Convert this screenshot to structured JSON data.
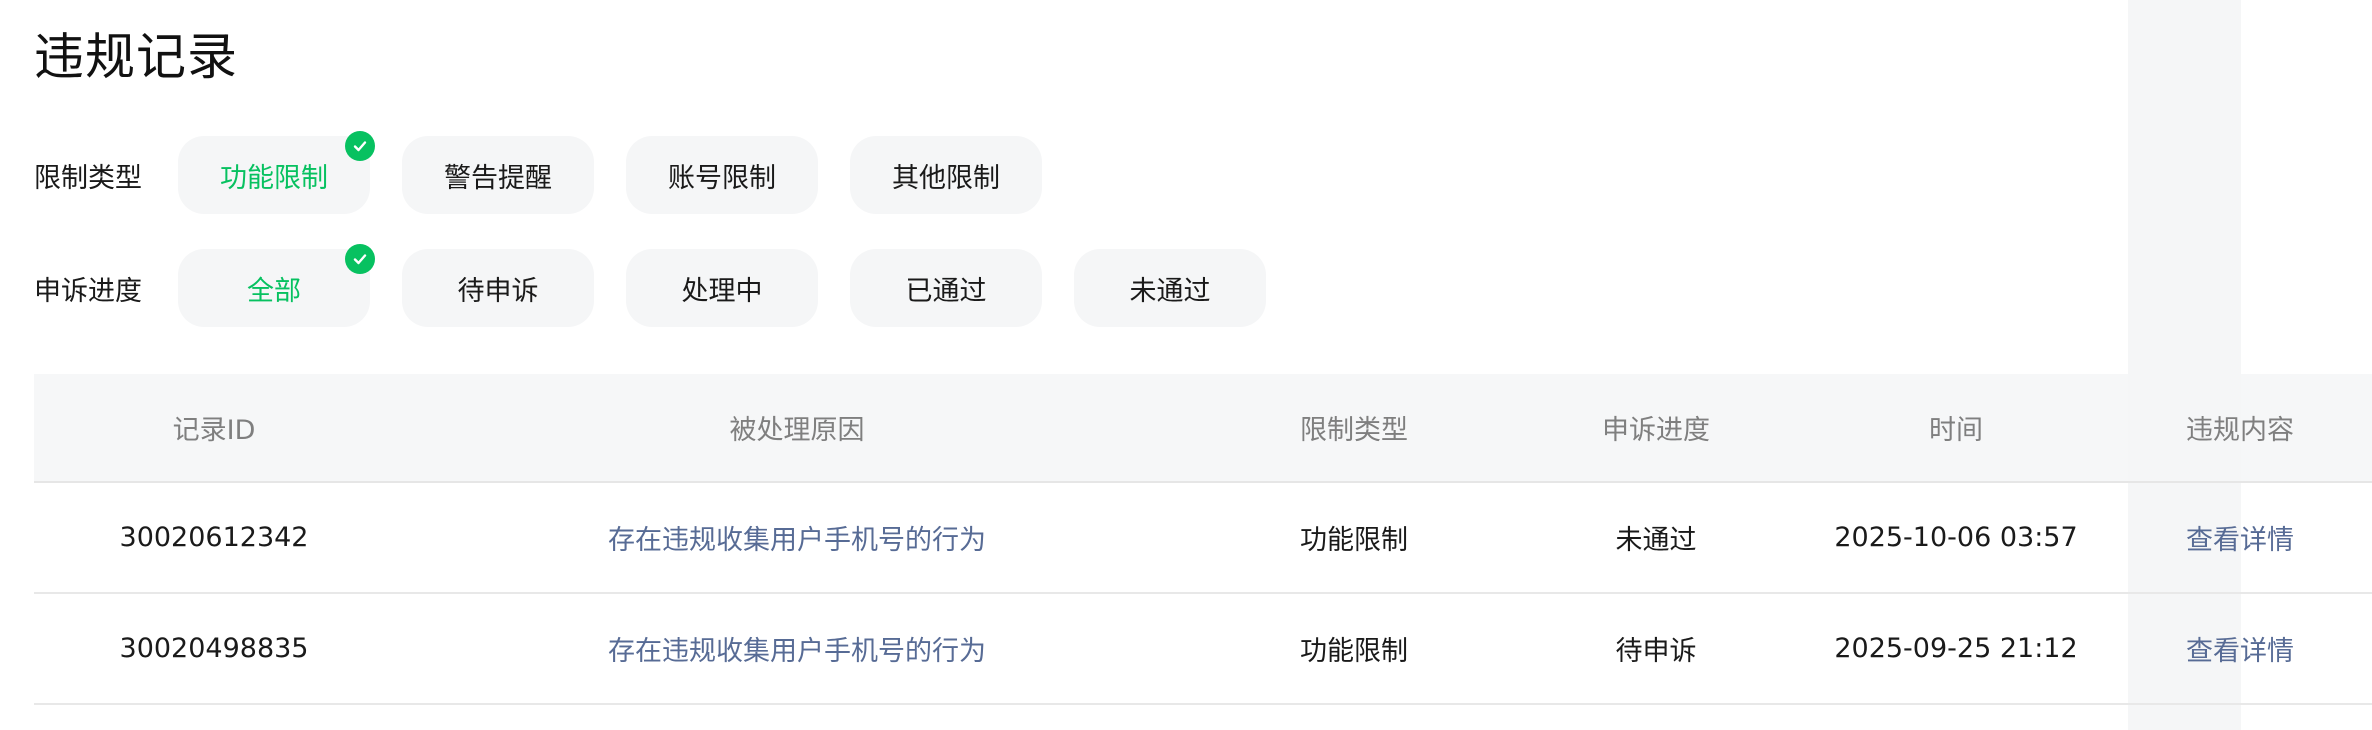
{
  "page": {
    "title": "违规记录"
  },
  "filters": {
    "restriction_type": {
      "label": "限制类型",
      "options": [
        "功能限制",
        "警告提醒",
        "账号限制",
        "其他限制"
      ],
      "selected": "功能限制"
    },
    "appeal_progress": {
      "label": "申诉进度",
      "options": [
        "全部",
        "待申诉",
        "处理中",
        "已通过",
        "未通过"
      ],
      "selected": "全部"
    }
  },
  "table": {
    "headers": [
      "记录ID",
      "被处理原因",
      "限制类型",
      "申诉进度",
      "时间",
      "违规内容"
    ],
    "rows": [
      {
        "id": "30020612342",
        "reason": "存在违规收集用户手机号的行为",
        "type": "功能限制",
        "progress": "未通过",
        "time": "2025-10-06 03:57",
        "action": "查看详情"
      },
      {
        "id": "30020498835",
        "reason": "存在违规收集用户手机号的行为",
        "type": "功能限制",
        "progress": "待申诉",
        "time": "2025-09-25 21:12",
        "action": "查看详情"
      }
    ]
  },
  "colors": {
    "accent_green": "#07c160",
    "link_blue": "#576b95",
    "chip_bg": "#f5f6f7",
    "header_text": "#7f7f7f"
  },
  "icons": {
    "selected_marker": "check-icon"
  }
}
